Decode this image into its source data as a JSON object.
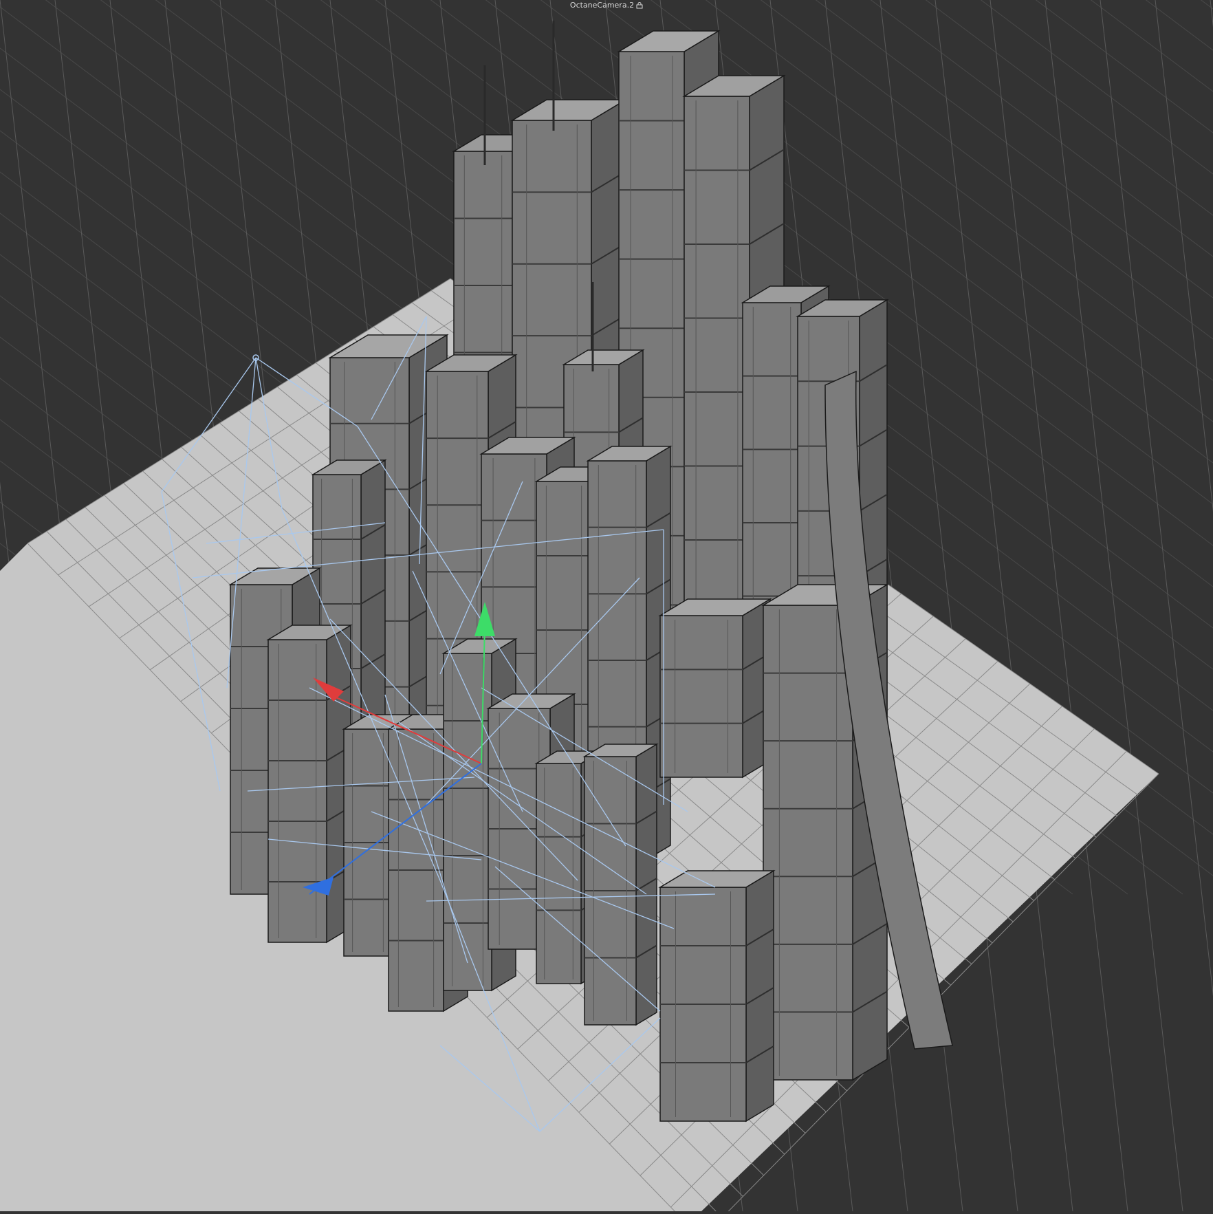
{
  "viewport": {
    "camera_name": "OctaneCamera.2",
    "background_color": "#333333",
    "floor_color": "#c6c6c6",
    "grid_color_dark": "#5a5a5a",
    "grid_color_light": "#8a8a8a",
    "building_color": "#7a7a7a",
    "edge_color": "#1a1a1a",
    "camera_wire_color": "#a9c8ee",
    "axis_colors": {
      "x": "#e03c3c",
      "y": "#3ddc68",
      "z": "#2f6fe0"
    }
  },
  "scene": {
    "objects": [
      "skyscraper-cluster",
      "camera-rig",
      "move-gizmo",
      "ground-plane"
    ],
    "gizmo_axes": [
      "x-axis-handle",
      "y-axis-handle",
      "z-axis-handle"
    ]
  }
}
